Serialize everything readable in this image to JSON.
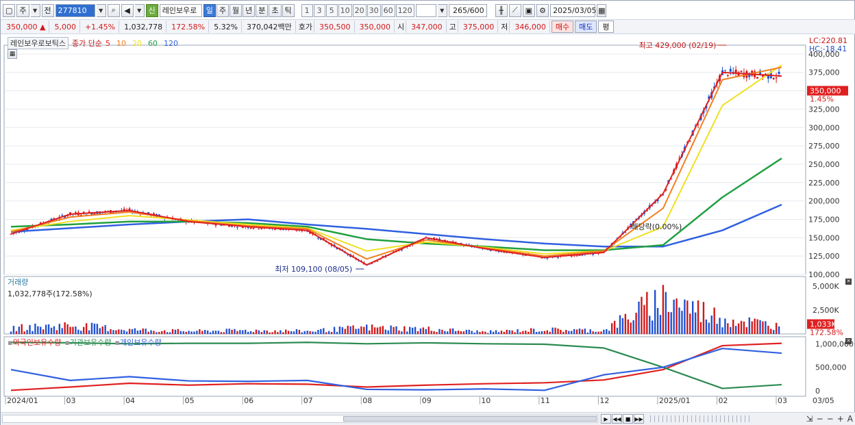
{
  "toolbar": {
    "market": "주",
    "prev_label": "전",
    "code": "277810",
    "new_badge": "신",
    "stock_name": "레인보우로",
    "periods": [
      "일",
      "주",
      "월",
      "년",
      "분",
      "초",
      "틱"
    ],
    "selected_period": "일",
    "intervals": [
      "1",
      "3",
      "5",
      "10",
      "20",
      "30",
      "60",
      "120"
    ],
    "count": "265",
    "count_max": "/600",
    "date": "2025/03/05"
  },
  "quote": {
    "price": "350,000",
    "change": "5,000",
    "change_pct": "+1.45%",
    "volume": "1,032,778",
    "volume_ratio": "172.58%",
    "turnover": "5.32%",
    "amount": "370,042백만",
    "bid_label": "호가",
    "ask": "350,500",
    "bid": "350,000",
    "open_label": "시",
    "open": "347,000",
    "high_label": "고",
    "high": "375,000",
    "low_label": "저",
    "low": "346,000",
    "buy": "매수",
    "sell": "매도",
    "avg": "평"
  },
  "price_panel": {
    "title": "레인보우로보틱스",
    "ma_label": "종가 단순",
    "ma_periods": [
      "5",
      "10",
      "20",
      "60",
      "120"
    ],
    "ma_colors": [
      "#e02020",
      "#f08020",
      "#f0e020",
      "#20a040",
      "#3060e0"
    ],
    "lc": "LC:220.81",
    "hc": "HC:-18.41",
    "current_price": "350,000",
    "current_pct": "1.45%",
    "high_note": "최고 429,000 (02/19)",
    "low_note": "최저 109,100 (08/05)",
    "dividend_note": "배당락(0.00%)",
    "y_ticks": [
      "400,000",
      "375,000",
      "350,000",
      "325,000",
      "300,000",
      "275,000",
      "250,000",
      "225,000",
      "200,000",
      "175,000",
      "150,000",
      "125,000",
      "100,000"
    ]
  },
  "volume_panel": {
    "title": "거래량",
    "value": "1,032,778주(172.58%)",
    "y_ticks": [
      "5,000K",
      "2,500K",
      "0"
    ],
    "current": "1,033K",
    "current_pct": "172.58%"
  },
  "holding_panel": {
    "series": [
      {
        "name": "외국인보유수량",
        "color": "#e02020"
      },
      {
        "name": "기관보유수량",
        "color": "#2a8a50"
      },
      {
        "name": "개인보유수량",
        "color": "#3060e0"
      }
    ],
    "y_ticks": [
      "1,000,000",
      "500,000",
      "0"
    ]
  },
  "x_axis": {
    "labels": [
      "2024/01",
      "03",
      "04",
      "05",
      "06",
      "07",
      "08",
      "09",
      "10",
      "11",
      "12",
      "2025/01",
      "02",
      "03"
    ],
    "right_label": "03/05"
  },
  "chart_data": [
    {
      "type": "line",
      "title": "레인보우로보틱스",
      "x": [
        "2024/01",
        "03",
        "04",
        "05",
        "06",
        "07",
        "08",
        "09",
        "10",
        "11",
        "12",
        "2025/01",
        "02",
        "03"
      ],
      "ylim": [
        100000,
        412000
      ],
      "series": [
        {
          "name": "5",
          "values": [
            155000,
            182000,
            187000,
            172000,
            165000,
            160000,
            113000,
            150000,
            135000,
            123000,
            130000,
            210000,
            375000,
            370000
          ]
        },
        {
          "name": "10",
          "values": [
            158000,
            178000,
            185000,
            173000,
            166000,
            162000,
            121000,
            147000,
            136000,
            125000,
            132000,
            190000,
            365000,
            382000
          ]
        },
        {
          "name": "20",
          "values": [
            160000,
            172000,
            180000,
            174000,
            168000,
            163000,
            132000,
            144000,
            137000,
            128000,
            132000,
            165000,
            330000,
            385000
          ]
        },
        {
          "name": "60",
          "values": [
            165000,
            168000,
            172000,
            172000,
            170000,
            165000,
            148000,
            142000,
            138000,
            133000,
            133000,
            140000,
            205000,
            258000
          ]
        },
        {
          "name": "120",
          "values": [
            158000,
            163000,
            168000,
            172000,
            175000,
            168000,
            162000,
            155000,
            148000,
            142000,
            138000,
            138000,
            160000,
            195000
          ]
        }
      ]
    },
    {
      "type": "bar",
      "title": "거래량",
      "x": [
        "2024/01",
        "03",
        "04",
        "05",
        "06",
        "07",
        "08",
        "09",
        "10",
        "11",
        "12",
        "2025/01",
        "02",
        "03"
      ],
      "values": [
        800000,
        1200000,
        600000,
        400000,
        500000,
        400000,
        900000,
        700000,
        300000,
        600000,
        500000,
        5000000,
        2200000,
        1033000
      ],
      "ylim": [
        0,
        6000000
      ]
    },
    {
      "type": "line",
      "title": "보유수량",
      "x": [
        "2024/01",
        "03",
        "04",
        "05",
        "06",
        "07",
        "08",
        "09",
        "10",
        "11",
        "12",
        "2025/01",
        "02",
        "03"
      ],
      "ylim": [
        0,
        1150000
      ],
      "series": [
        {
          "name": "외국인보유수량",
          "values": [
            10000,
            80000,
            160000,
            120000,
            150000,
            140000,
            80000,
            120000,
            150000,
            170000,
            230000,
            450000,
            960000,
            1010000
          ]
        },
        {
          "name": "기관보유수량",
          "values": [
            1030000,
            1020000,
            1000000,
            1010000,
            1010000,
            1030000,
            1000000,
            1020000,
            1000000,
            990000,
            910000,
            500000,
            50000,
            130000
          ]
        },
        {
          "name": "개인보유수량",
          "values": [
            450000,
            220000,
            300000,
            210000,
            200000,
            220000,
            30000,
            20000,
            40000,
            10000,
            340000,
            500000,
            900000,
            800000
          ]
        }
      ]
    }
  ]
}
